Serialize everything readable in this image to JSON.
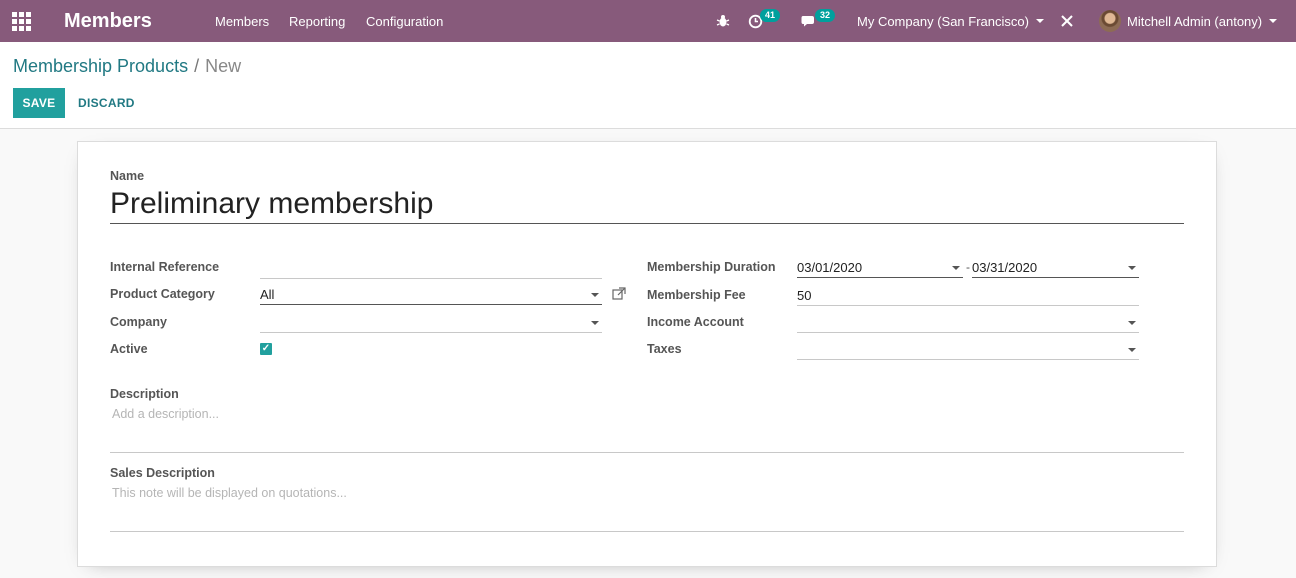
{
  "navbar": {
    "app_title": "Members",
    "menu": [
      "Members",
      "Reporting",
      "Configuration"
    ],
    "activity_count": "41",
    "message_count": "32",
    "company": "My Company (San Francisco)",
    "user": "Mitchell Admin (antony)",
    "color": "#875a7b"
  },
  "breadcrumb": {
    "parent": "Membership Products",
    "separator": "/",
    "current": "New"
  },
  "actions": {
    "save": "SAVE",
    "discard": "DISCARD"
  },
  "form": {
    "name_label": "Name",
    "name_value": "Preliminary membership",
    "left": {
      "internal_reference": {
        "label": "Internal Reference",
        "value": ""
      },
      "product_category": {
        "label": "Product Category",
        "value": "All"
      },
      "company": {
        "label": "Company",
        "value": ""
      },
      "active": {
        "label": "Active",
        "checked": true
      }
    },
    "right": {
      "membership_duration": {
        "label": "Membership Duration",
        "start": "03/01/2020",
        "separator": "-",
        "end": "03/31/2020"
      },
      "membership_fee": {
        "label": "Membership Fee",
        "value": "50"
      },
      "income_account": {
        "label": "Income Account",
        "value": ""
      },
      "taxes": {
        "label": "Taxes",
        "value": ""
      }
    },
    "description": {
      "label": "Description",
      "placeholder": "Add a description..."
    },
    "sales_description": {
      "label": "Sales Description",
      "placeholder": "This note will be displayed on quotations..."
    }
  },
  "colors": {
    "primary": "#21a09e",
    "link": "#217983",
    "badge": "#00a09d"
  }
}
